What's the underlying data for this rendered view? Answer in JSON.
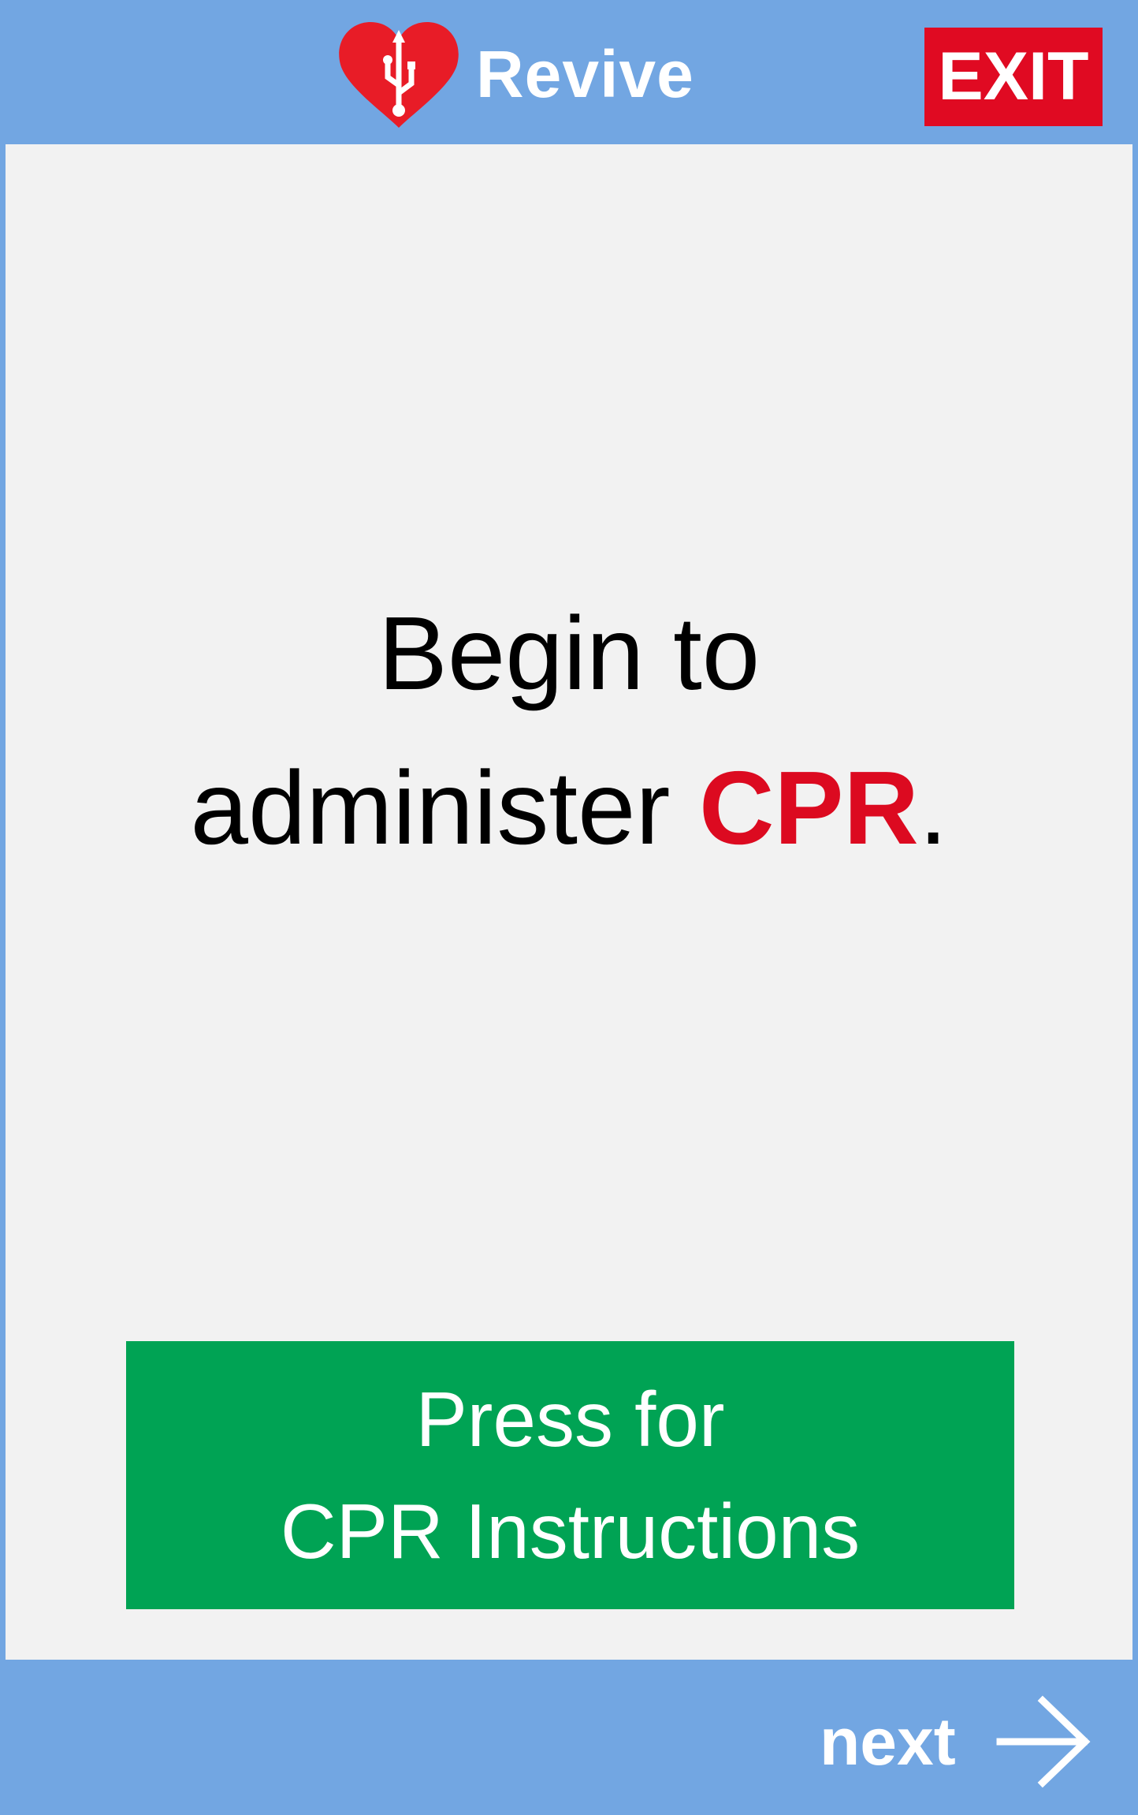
{
  "header": {
    "app_name": "Revive",
    "logo_icon": "heart-usb-icon",
    "exit_label": "EXIT"
  },
  "main": {
    "message_line1": "Begin to",
    "message_line2_prefix": "administer ",
    "message_highlight": "CPR",
    "message_suffix": ".",
    "instructions_button": {
      "line1": "Press for",
      "line2": "CPR Instructions"
    }
  },
  "footer": {
    "next_label": "next",
    "next_icon": "arrow-right-icon"
  },
  "colors": {
    "bar_blue": "#72a6e2",
    "panel_gray": "#f2f2f2",
    "alert_red": "#e00a22",
    "action_green": "#00a354",
    "text_black": "#000000",
    "text_white": "#ffffff"
  }
}
